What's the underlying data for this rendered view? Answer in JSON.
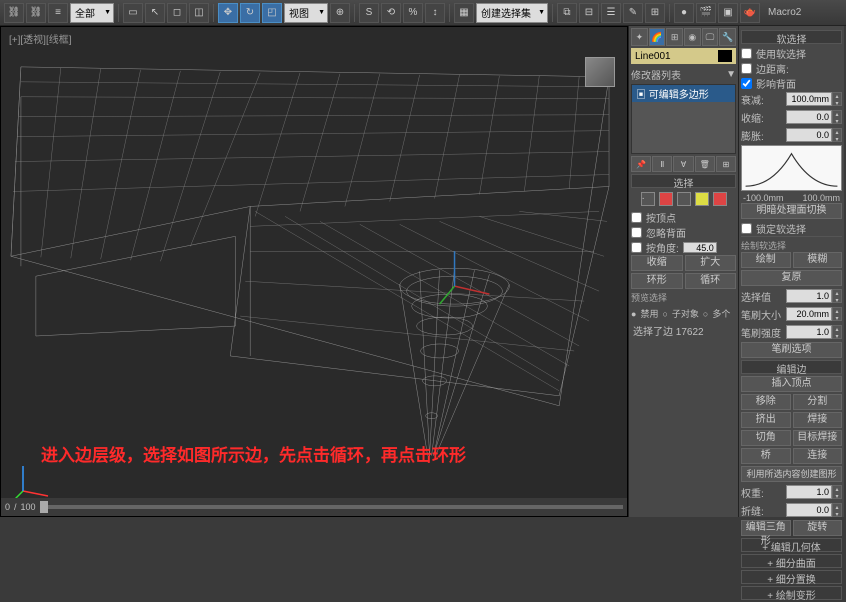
{
  "toolbar": {
    "view_dd": "视图",
    "create_dd": "创建选择集",
    "macro_label": "Macro2"
  },
  "viewport": {
    "label": "[+][透视][线框]",
    "instruction": "进入边层级，选择如图所示边，先点击循环，再点击环形"
  },
  "modifier": {
    "object_name": "Line001",
    "stack_label": "修改器列表",
    "stack_item": "可编辑多边形"
  },
  "selection": {
    "header": "选择",
    "by_vertex": "按顶点",
    "ignore_backface": "忽略背面",
    "by_angle": "按角度:",
    "angle_val": "45.0",
    "shrink": "收缩",
    "grow": "扩大",
    "ring": "环形",
    "loop": "循环",
    "preview_label": "预览选择",
    "disable": "禁用",
    "sub_obj": "子对象",
    "multi": "多个",
    "status": "选择了边 17622"
  },
  "soft_sel": {
    "header": "软选择",
    "use_soft": "使用软选择",
    "edge_dist": "边距离:",
    "affect_backface": "影响背面",
    "falloff": "衰减:",
    "falloff_val": "100.0mm",
    "pinch": "收缩:",
    "pinch_val": "0.0",
    "bubble": "膨胀:",
    "bubble_val": "0.0",
    "axis_min": "-100.0mm",
    "axis_max": "100.0mm",
    "shaded_face": "明暗处理面切换",
    "lock_soft": "锁定软选择",
    "paint_sel_header": "绘制软选择",
    "paint": "绘制",
    "blur": "模糊",
    "revert": "复原",
    "sel_value": "选择值",
    "sel_value_v": "1.0",
    "brush_size": "笔刷大小",
    "brush_size_v": "20.0mm",
    "brush_strength": "笔刷强度",
    "brush_strength_v": "1.0",
    "brush_options": "笔刷选项"
  },
  "edit_edges": {
    "header": "编辑边",
    "insert_vertex": "插入顶点",
    "remove": "移除",
    "split": "分割",
    "extrude": "挤出",
    "weld": "焊接",
    "chamfer": "切角",
    "target_weld": "目标焊接",
    "bridge": "桥",
    "connect": "连接",
    "create_shape": "利用所选内容创建图形",
    "weight": "权重:",
    "weight_v": "1.0",
    "crease": "折缝:",
    "crease_v": "0.0",
    "edit_tri": "编辑三角形",
    "turn": "旋转"
  },
  "rollouts": {
    "edit_geom": "编辑几何体",
    "subdiv_surf": "细分曲面",
    "subdiv_disp": "细分置换",
    "paint_deform": "绘制变形"
  },
  "slider": {
    "min": "0",
    "max": "100"
  }
}
